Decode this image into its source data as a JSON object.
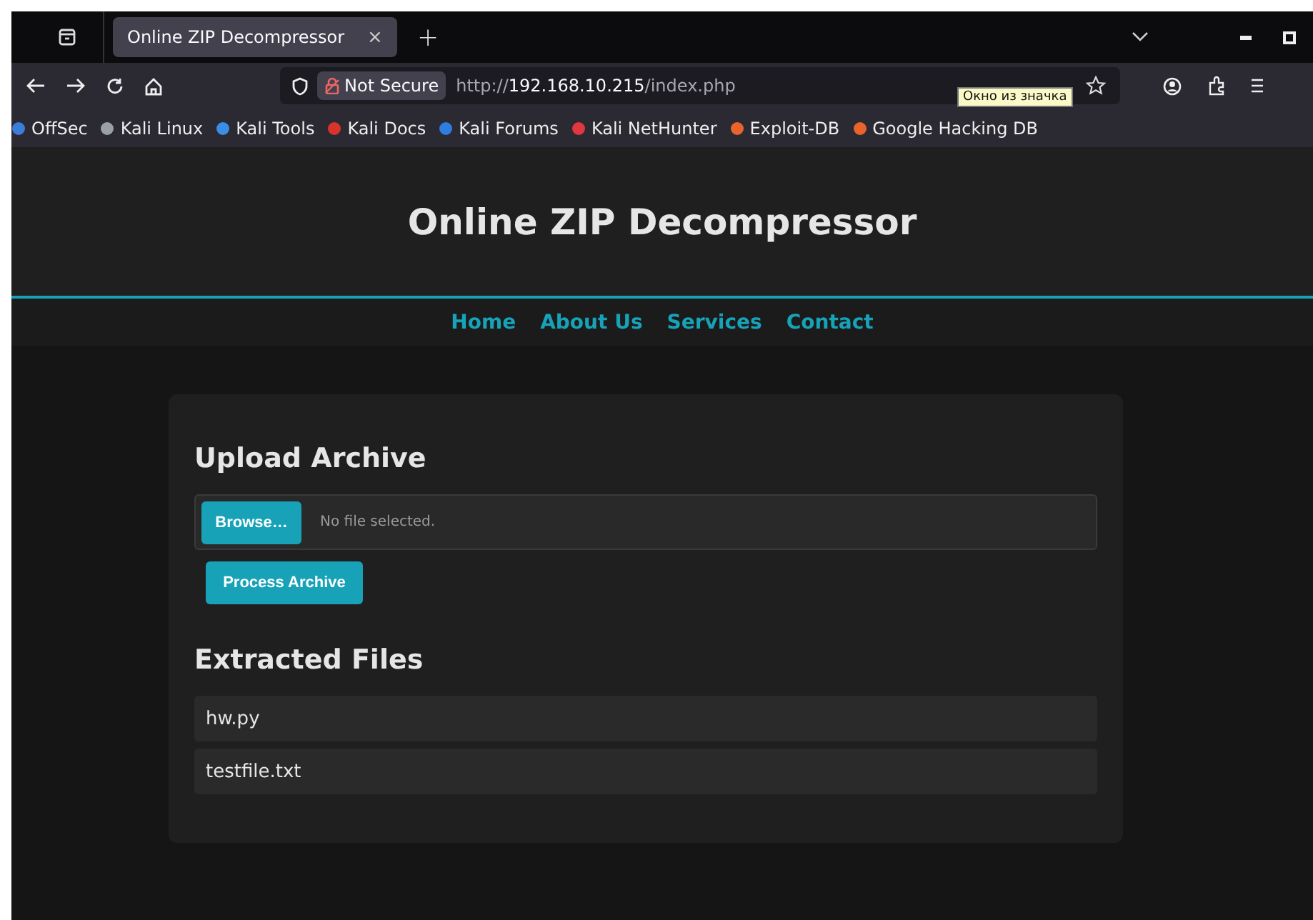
{
  "tabs": [
    {
      "title": "Online ZIP Decompressor",
      "selected": true,
      "close": "×"
    }
  ],
  "new_tab": "+",
  "address_bar": {
    "security_label": "Not Secure",
    "url_scheme": "http://",
    "url_host": "192.168.10.215",
    "url_path": "/index.php"
  },
  "tooltip": "Окно из значка",
  "bookmarks": [
    {
      "label": "OffSec",
      "color": "#3b7dd8"
    },
    {
      "label": "Kali Linux",
      "color": "#9aa0a6"
    },
    {
      "label": "Kali Tools",
      "color": "#3a8ee6"
    },
    {
      "label": "Kali Docs",
      "color": "#d9342b"
    },
    {
      "label": "Kali Forums",
      "color": "#2f7de1"
    },
    {
      "label": "Kali NetHunter",
      "color": "#e0383e"
    },
    {
      "label": "Exploit-DB",
      "color": "#e8642c"
    },
    {
      "label": "Google Hacking DB",
      "color": "#e8642c"
    }
  ],
  "site": {
    "title": "Online ZIP Decompressor",
    "nav": [
      "Home",
      "About Us",
      "Services",
      "Contact"
    ],
    "upload": {
      "heading": "Upload Archive",
      "browse_button": "Browse…",
      "file_status": "No file selected.",
      "submit_button": "Process Archive"
    },
    "extracted": {
      "heading": "Extracted Files",
      "files": [
        "hw.py",
        "testfile.txt"
      ]
    }
  }
}
